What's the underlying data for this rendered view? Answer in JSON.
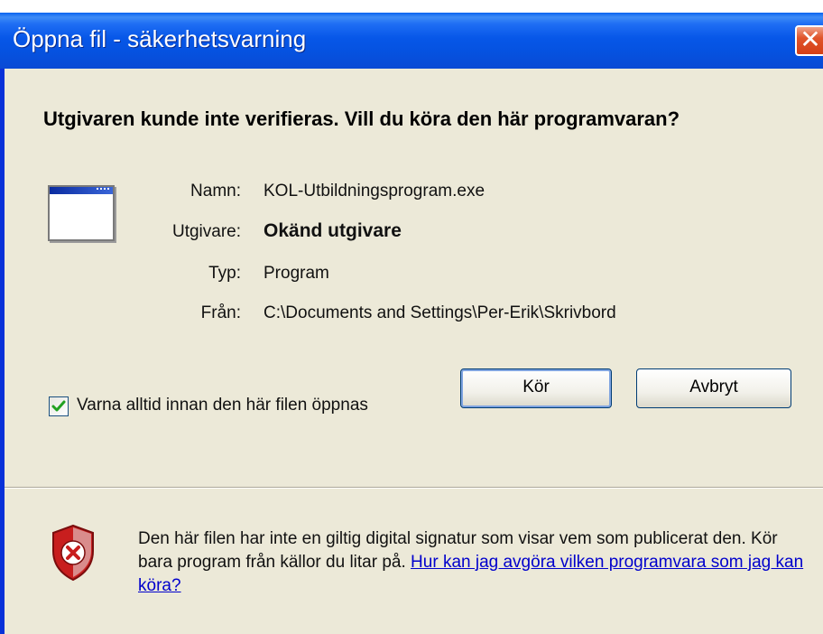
{
  "dialog": {
    "title": "Öppna fil - säkerhetsvarning",
    "close_glyph": "✕",
    "headline": "Utgivaren kunde inte verifieras. Vill du köra den här programvaran?",
    "fields": [
      {
        "label": "Namn:",
        "value": "KOL-Utbildningsprogram.exe"
      },
      {
        "label": "Utgivare:",
        "value": "Okänd utgivare"
      },
      {
        "label": "Typ:",
        "value": "Program"
      },
      {
        "label": "Från:",
        "value": "C:\\Documents and Settings\\Per-Erik\\Skrivbord"
      }
    ],
    "buttons": {
      "run": "Kör",
      "cancel": "Avbryt"
    },
    "checkbox": {
      "label": "Varna alltid innan den här filen öppnas",
      "checked": true
    },
    "warning": {
      "text": "Den här filen har inte en giltig digital signatur som visar vem som publicerat den. Kör bara program från källor du litar på.",
      "link": "Hur kan jag avgöra vilken programvara som jag kan köra?"
    }
  },
  "icons": {
    "app": "program-window-icon",
    "shield": "security-shield-icon",
    "check": "checkmark-icon",
    "close": "close-icon"
  },
  "colors": {
    "titlebar": "#0757e8",
    "close": "#e0542a",
    "panel": "#ece9d8",
    "link": "#0000cc",
    "shield_red": "#c81e1e"
  }
}
